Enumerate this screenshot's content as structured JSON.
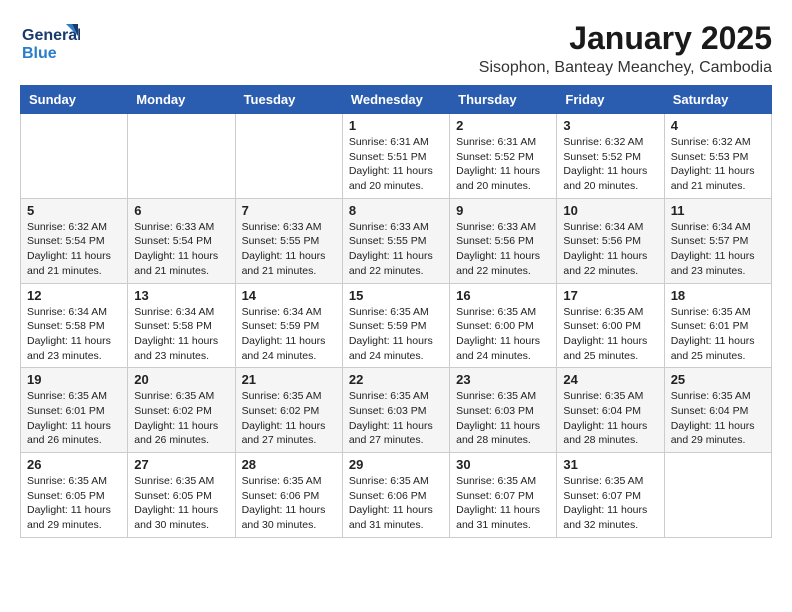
{
  "header": {
    "logo_line1": "General",
    "logo_line2": "Blue",
    "title": "January 2025",
    "subtitle": "Sisophon, Banteay Meanchey, Cambodia"
  },
  "days_of_week": [
    "Sunday",
    "Monday",
    "Tuesday",
    "Wednesday",
    "Thursday",
    "Friday",
    "Saturday"
  ],
  "weeks": [
    [
      {
        "day": "",
        "info": ""
      },
      {
        "day": "",
        "info": ""
      },
      {
        "day": "",
        "info": ""
      },
      {
        "day": "1",
        "info": "Sunrise: 6:31 AM\nSunset: 5:51 PM\nDaylight: 11 hours\nand 20 minutes."
      },
      {
        "day": "2",
        "info": "Sunrise: 6:31 AM\nSunset: 5:52 PM\nDaylight: 11 hours\nand 20 minutes."
      },
      {
        "day": "3",
        "info": "Sunrise: 6:32 AM\nSunset: 5:52 PM\nDaylight: 11 hours\nand 20 minutes."
      },
      {
        "day": "4",
        "info": "Sunrise: 6:32 AM\nSunset: 5:53 PM\nDaylight: 11 hours\nand 21 minutes."
      }
    ],
    [
      {
        "day": "5",
        "info": "Sunrise: 6:32 AM\nSunset: 5:54 PM\nDaylight: 11 hours\nand 21 minutes."
      },
      {
        "day": "6",
        "info": "Sunrise: 6:33 AM\nSunset: 5:54 PM\nDaylight: 11 hours\nand 21 minutes."
      },
      {
        "day": "7",
        "info": "Sunrise: 6:33 AM\nSunset: 5:55 PM\nDaylight: 11 hours\nand 21 minutes."
      },
      {
        "day": "8",
        "info": "Sunrise: 6:33 AM\nSunset: 5:55 PM\nDaylight: 11 hours\nand 22 minutes."
      },
      {
        "day": "9",
        "info": "Sunrise: 6:33 AM\nSunset: 5:56 PM\nDaylight: 11 hours\nand 22 minutes."
      },
      {
        "day": "10",
        "info": "Sunrise: 6:34 AM\nSunset: 5:56 PM\nDaylight: 11 hours\nand 22 minutes."
      },
      {
        "day": "11",
        "info": "Sunrise: 6:34 AM\nSunset: 5:57 PM\nDaylight: 11 hours\nand 23 minutes."
      }
    ],
    [
      {
        "day": "12",
        "info": "Sunrise: 6:34 AM\nSunset: 5:58 PM\nDaylight: 11 hours\nand 23 minutes."
      },
      {
        "day": "13",
        "info": "Sunrise: 6:34 AM\nSunset: 5:58 PM\nDaylight: 11 hours\nand 23 minutes."
      },
      {
        "day": "14",
        "info": "Sunrise: 6:34 AM\nSunset: 5:59 PM\nDaylight: 11 hours\nand 24 minutes."
      },
      {
        "day": "15",
        "info": "Sunrise: 6:35 AM\nSunset: 5:59 PM\nDaylight: 11 hours\nand 24 minutes."
      },
      {
        "day": "16",
        "info": "Sunrise: 6:35 AM\nSunset: 6:00 PM\nDaylight: 11 hours\nand 24 minutes."
      },
      {
        "day": "17",
        "info": "Sunrise: 6:35 AM\nSunset: 6:00 PM\nDaylight: 11 hours\nand 25 minutes."
      },
      {
        "day": "18",
        "info": "Sunrise: 6:35 AM\nSunset: 6:01 PM\nDaylight: 11 hours\nand 25 minutes."
      }
    ],
    [
      {
        "day": "19",
        "info": "Sunrise: 6:35 AM\nSunset: 6:01 PM\nDaylight: 11 hours\nand 26 minutes."
      },
      {
        "day": "20",
        "info": "Sunrise: 6:35 AM\nSunset: 6:02 PM\nDaylight: 11 hours\nand 26 minutes."
      },
      {
        "day": "21",
        "info": "Sunrise: 6:35 AM\nSunset: 6:02 PM\nDaylight: 11 hours\nand 27 minutes."
      },
      {
        "day": "22",
        "info": "Sunrise: 6:35 AM\nSunset: 6:03 PM\nDaylight: 11 hours\nand 27 minutes."
      },
      {
        "day": "23",
        "info": "Sunrise: 6:35 AM\nSunset: 6:03 PM\nDaylight: 11 hours\nand 28 minutes."
      },
      {
        "day": "24",
        "info": "Sunrise: 6:35 AM\nSunset: 6:04 PM\nDaylight: 11 hours\nand 28 minutes."
      },
      {
        "day": "25",
        "info": "Sunrise: 6:35 AM\nSunset: 6:04 PM\nDaylight: 11 hours\nand 29 minutes."
      }
    ],
    [
      {
        "day": "26",
        "info": "Sunrise: 6:35 AM\nSunset: 6:05 PM\nDaylight: 11 hours\nand 29 minutes."
      },
      {
        "day": "27",
        "info": "Sunrise: 6:35 AM\nSunset: 6:05 PM\nDaylight: 11 hours\nand 30 minutes."
      },
      {
        "day": "28",
        "info": "Sunrise: 6:35 AM\nSunset: 6:06 PM\nDaylight: 11 hours\nand 30 minutes."
      },
      {
        "day": "29",
        "info": "Sunrise: 6:35 AM\nSunset: 6:06 PM\nDaylight: 11 hours\nand 31 minutes."
      },
      {
        "day": "30",
        "info": "Sunrise: 6:35 AM\nSunset: 6:07 PM\nDaylight: 11 hours\nand 31 minutes."
      },
      {
        "day": "31",
        "info": "Sunrise: 6:35 AM\nSunset: 6:07 PM\nDaylight: 11 hours\nand 32 minutes."
      },
      {
        "day": "",
        "info": ""
      }
    ]
  ]
}
